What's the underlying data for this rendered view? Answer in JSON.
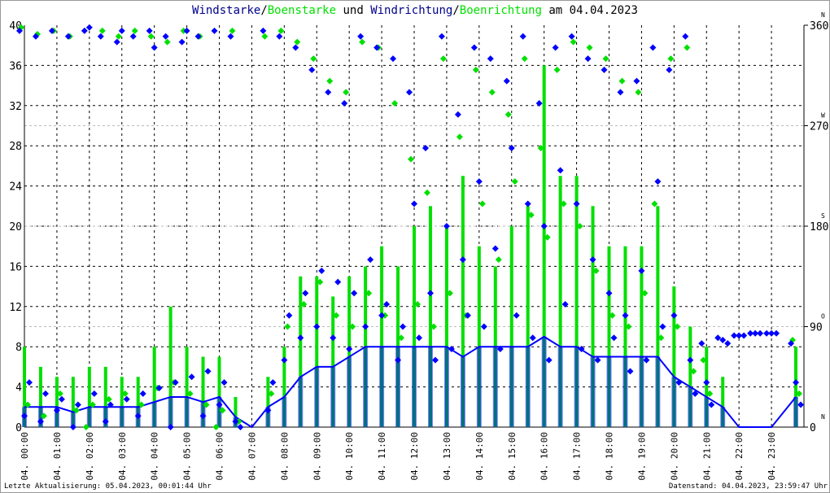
{
  "title": {
    "p1": "Windstarke",
    "s1": "/",
    "p2": "Boenstarke",
    "p3": " und ",
    "p4": "Windrichtung",
    "s2": "/",
    "p5": "Boenrichtung",
    "p6": " am 04.04.2023"
  },
  "footer": {
    "left": "Letzte Aktualisierung: 05.04.2023, 00:01:44 Uhr",
    "right": "Datenstand: 04.04.2023, 23:59:47 Uhr"
  },
  "chart_data": {
    "type": "line",
    "title": "Windstarke/Boenstarke und Windrichtung/Boenrichtung am 04.04.2023",
    "left_axis": {
      "ylim": [
        0,
        40
      ],
      "ticks": [
        "0",
        "4",
        "8",
        "12",
        "16",
        "20",
        "24",
        "28",
        "32",
        "36",
        "40"
      ]
    },
    "right_axis": {
      "ylim": [
        0,
        360
      ],
      "ticks": [
        "0",
        "90",
        "180",
        "270",
        "360"
      ],
      "compass": [
        "N",
        "O",
        "S",
        "W",
        "N"
      ]
    },
    "x_ticks": [
      "04. 00:00",
      "04. 01:00",
      "04. 02:00",
      "04. 03:00",
      "04. 04:00",
      "04. 05:00",
      "04. 06:00",
      "04. 07:00",
      "04. 08:00",
      "04. 09:00",
      "04. 10:00",
      "04. 11:00",
      "04. 12:00",
      "04. 13:00",
      "04. 14:00",
      "04. 15:00",
      "04. 16:00",
      "04. 17:00",
      "04. 18:00",
      "04. 19:00",
      "04. 20:00",
      "04. 21:00",
      "04. 22:00",
      "04. 23:00"
    ],
    "x_hours": [
      0,
      0.5,
      1,
      1.5,
      2,
      2.5,
      3,
      3.5,
      4,
      4.5,
      5,
      5.5,
      6,
      6.5,
      7,
      7.5,
      8,
      8.5,
      9,
      9.5,
      10,
      10.5,
      11,
      11.5,
      12,
      12.5,
      13,
      13.5,
      14,
      14.5,
      15,
      15.5,
      16,
      16.5,
      17,
      17.5,
      18,
      18.5,
      19,
      19.5,
      20,
      20.5,
      21,
      21.5,
      22,
      22.5,
      23,
      23.75
    ],
    "series": [
      {
        "name": "Windstarke",
        "color": "#0000ff",
        "values": [
          2,
          2,
          2,
          1.5,
          2,
          2,
          2,
          2,
          2.5,
          3,
          3,
          2.5,
          3,
          1,
          0,
          2,
          3,
          5,
          6,
          6,
          7,
          8,
          8,
          8,
          8,
          8,
          8,
          7,
          8,
          8,
          8,
          8,
          9,
          8,
          8,
          7,
          7,
          7,
          7,
          7,
          5,
          4,
          3,
          2,
          0,
          0,
          0,
          3
        ]
      },
      {
        "name": "Boenstarke",
        "color": "#00e000",
        "values": [
          8,
          6,
          5,
          5,
          6,
          6,
          5,
          5,
          8,
          12,
          8,
          7,
          7,
          3,
          0,
          5,
          8,
          15,
          15,
          13,
          15,
          16,
          18,
          16,
          20,
          22,
          20,
          25,
          18,
          16,
          20,
          22,
          36,
          25,
          25,
          22,
          18,
          18,
          18,
          22,
          14,
          10,
          8,
          5,
          0,
          0,
          0,
          8
        ]
      },
      {
        "name": "Windrichtung",
        "color": "#0000ff",
        "values": [
          [
            355,
            10,
            40
          ],
          [
            350,
            5,
            30
          ],
          [
            355,
            15,
            25
          ],
          [
            350,
            0,
            20
          ],
          [
            355,
            358,
            30
          ],
          [
            350,
            5,
            20
          ],
          [
            345,
            355,
            25
          ],
          [
            350,
            10,
            30
          ],
          [
            355,
            340,
            35
          ],
          [
            350,
            0,
            40
          ],
          [
            345,
            355,
            45
          ],
          [
            350,
            10,
            50
          ],
          [
            355,
            20,
            40
          ],
          [
            350,
            5,
            0
          ],
          [
            null,
            null,
            null
          ],
          [
            355,
            15,
            40
          ],
          [
            350,
            60,
            100
          ],
          [
            340,
            80,
            120
          ],
          [
            320,
            90,
            140
          ],
          [
            300,
            80,
            130
          ],
          [
            290,
            70,
            120
          ],
          [
            350,
            90,
            150
          ],
          [
            340,
            100,
            110
          ],
          [
            330,
            60,
            90
          ],
          [
            300,
            200,
            80
          ],
          [
            250,
            120,
            60
          ],
          [
            350,
            180,
            70
          ],
          [
            280,
            150,
            100
          ],
          [
            340,
            220,
            90
          ],
          [
            330,
            160,
            70
          ],
          [
            310,
            250,
            100
          ],
          [
            350,
            200,
            80
          ],
          [
            290,
            180,
            60
          ],
          [
            340,
            230,
            110
          ],
          [
            350,
            200,
            70
          ],
          [
            330,
            150,
            60
          ],
          [
            320,
            120,
            80
          ],
          [
            300,
            100,
            50
          ],
          [
            310,
            140,
            60
          ],
          [
            340,
            220,
            90
          ],
          [
            320,
            100,
            40
          ],
          [
            350,
            60,
            30
          ],
          [
            75,
            40,
            20
          ],
          [
            80,
            78,
            75
          ],
          [
            82,
            82,
            82
          ],
          [
            84,
            84,
            84
          ],
          [
            84,
            84,
            84
          ],
          [
            75,
            40,
            20
          ]
        ]
      },
      {
        "name": "Boenrichtung",
        "color": "#00e000",
        "values": [
          [
            358,
            20
          ],
          [
            352,
            10
          ],
          [
            355,
            30
          ],
          [
            350,
            15
          ],
          [
            0,
            20
          ],
          [
            355,
            25
          ],
          [
            350,
            30
          ],
          [
            355,
            20
          ],
          [
            350,
            35
          ],
          [
            345,
            40
          ],
          [
            355,
            30
          ],
          [
            350,
            20
          ],
          [
            0,
            15
          ],
          [
            355,
            5
          ],
          [
            null,
            null
          ],
          [
            350,
            30
          ],
          [
            355,
            90
          ],
          [
            345,
            110
          ],
          [
            330,
            130
          ],
          [
            310,
            100
          ],
          [
            300,
            90
          ],
          [
            345,
            120
          ],
          [
            340,
            100
          ],
          [
            290,
            80
          ],
          [
            240,
            110
          ],
          [
            210,
            90
          ],
          [
            330,
            120
          ],
          [
            260,
            100
          ],
          [
            320,
            200
          ],
          [
            300,
            150
          ],
          [
            280,
            220
          ],
          [
            330,
            190
          ],
          [
            250,
            170
          ],
          [
            320,
            200
          ],
          [
            345,
            180
          ],
          [
            340,
            140
          ],
          [
            330,
            100
          ],
          [
            310,
            90
          ],
          [
            300,
            120
          ],
          [
            200,
            80
          ],
          [
            330,
            90
          ],
          [
            340,
            50
          ],
          [
            60,
            30
          ],
          [
            null,
            null
          ],
          [
            null,
            null
          ],
          [
            null,
            null
          ],
          [
            null,
            null
          ],
          [
            78,
            30
          ]
        ]
      }
    ],
    "grid": true
  }
}
